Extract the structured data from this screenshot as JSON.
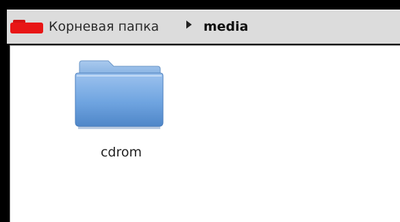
{
  "breadcrumb": {
    "root_label": "Корневая папка",
    "root_icon": "drive-icon",
    "separator_icon": "triangle-right-icon",
    "current_label": "media"
  },
  "files": [
    {
      "name": "cdrom",
      "icon": "folder-icon"
    }
  ],
  "colors": {
    "drive_red": "#e81616",
    "folder_blue": "#5f9be0",
    "pathbar_bg": "#dcdcdc",
    "content_bg": "#ffffff"
  }
}
